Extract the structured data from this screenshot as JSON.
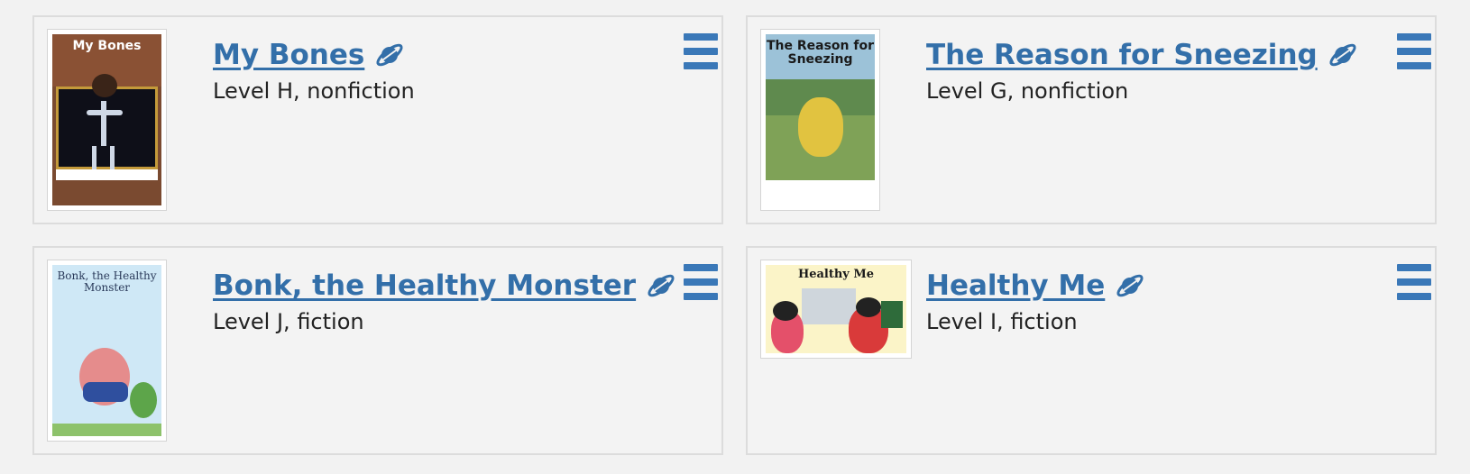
{
  "books": [
    {
      "title": "My Bones",
      "level": "Level H, nonfiction",
      "cover_text": "My Bones"
    },
    {
      "title": "The Reason for Sneezing",
      "level": "Level G, nonfiction",
      "cover_text": "The Reason for Sneezing"
    },
    {
      "title": "Bonk, the Healthy Monster",
      "level": "Level J, fiction",
      "cover_text": "Bonk, the Healthy Monster"
    },
    {
      "title": "Healthy Me",
      "level": "Level I, fiction",
      "cover_text": "Healthy Me"
    }
  ],
  "icons": {
    "planet": "planet-icon",
    "menu": "hamburger-menu-icon"
  },
  "colors": {
    "link": "#336fa9",
    "menu": "#3a78b8",
    "card_border": "#dcdcdc"
  }
}
